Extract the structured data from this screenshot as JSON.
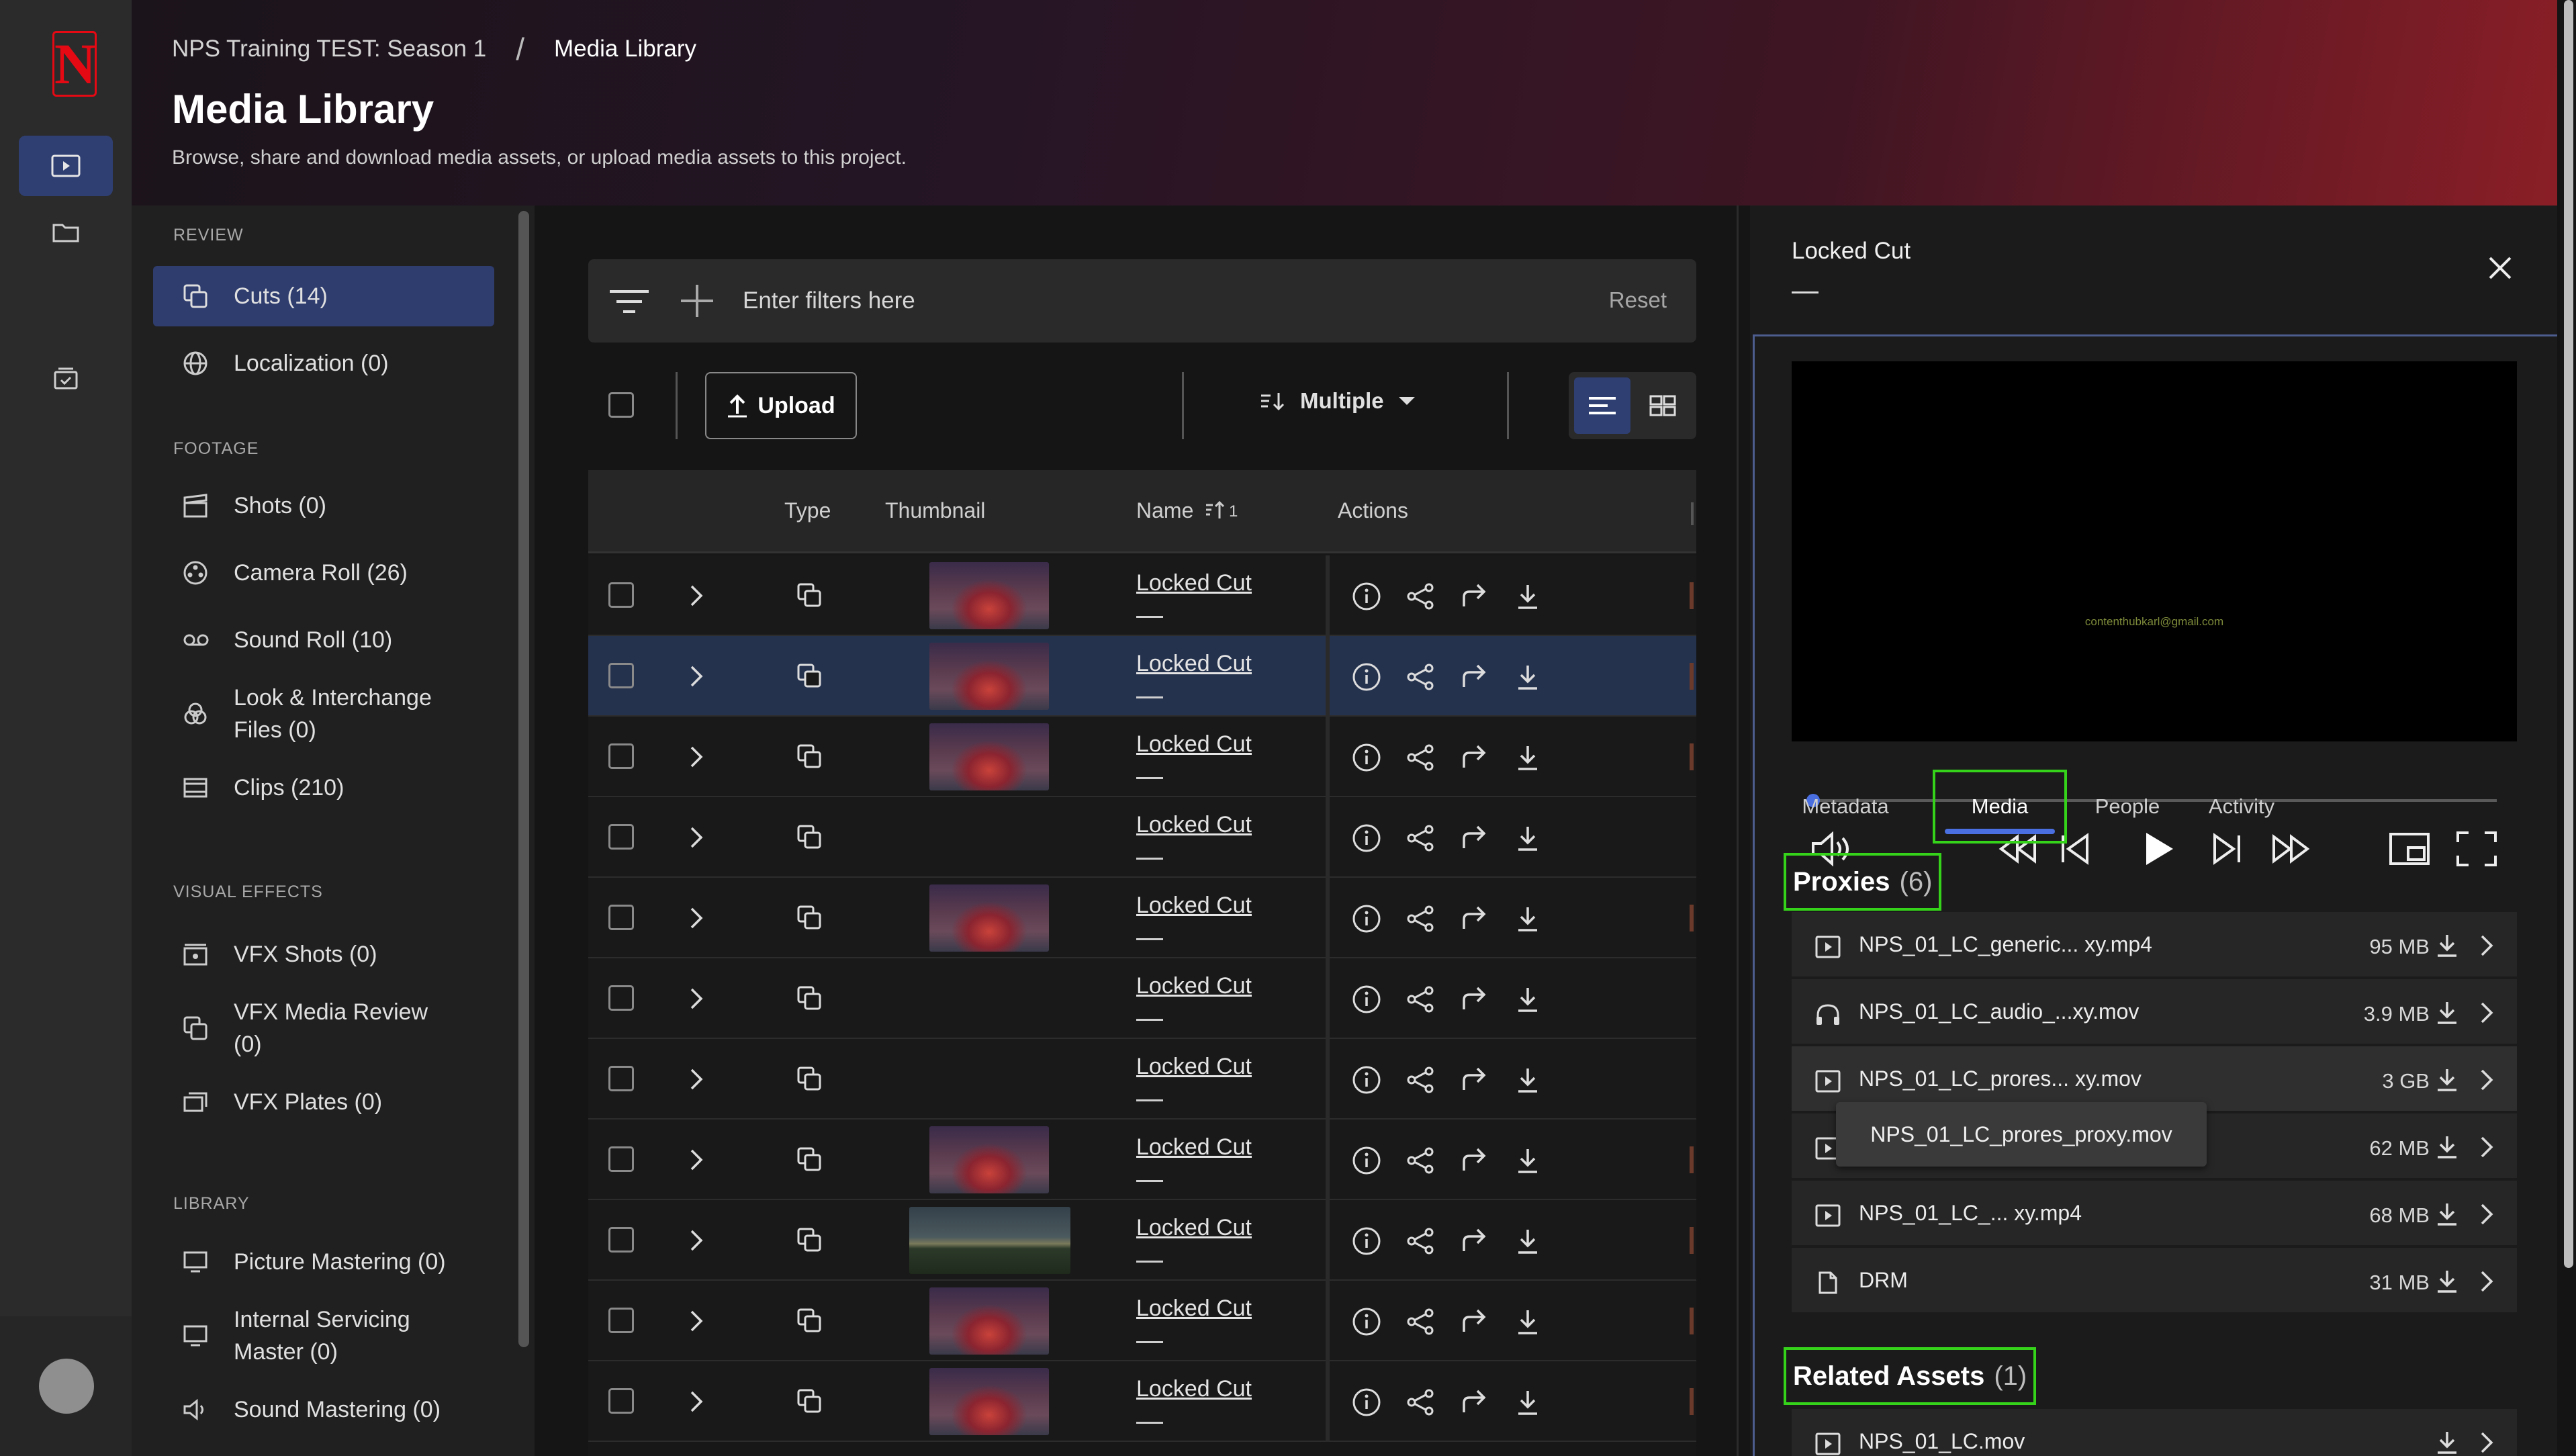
{
  "brand": {
    "logo_letter": "N",
    "accent": "#e50914"
  },
  "header": {
    "breadcrumb_project": "NPS Training TEST: Season 1",
    "breadcrumb_sep": "/",
    "breadcrumb_current": "Media Library",
    "title": "Media Library",
    "subtitle": "Browse, share and download media assets, or upload media assets to this project."
  },
  "sidenav": {
    "sections": [
      {
        "title": "REVIEW",
        "items": [
          {
            "label": "Cuts (14)",
            "icon": "cuts-icon",
            "selected": true
          },
          {
            "label": "Localization (0)",
            "icon": "globe-icon"
          }
        ]
      },
      {
        "title": "FOOTAGE",
        "items": [
          {
            "label": "Shots (0)",
            "icon": "clapper-icon"
          },
          {
            "label": "Camera Roll (26)",
            "icon": "film-reel-icon"
          },
          {
            "label": "Sound Roll (10)",
            "icon": "tape-icon"
          },
          {
            "label": "Look & Interchange Files (0)",
            "icon": "color-wheel-icon"
          },
          {
            "label": "Clips (210)",
            "icon": "film-strip-icon"
          }
        ]
      },
      {
        "title": "VISUAL EFFECTS",
        "items": [
          {
            "label": "VFX Shots (0)",
            "icon": "vfx-shot-icon"
          },
          {
            "label": "VFX Media Review (0)",
            "icon": "vfx-review-icon"
          },
          {
            "label": "VFX Plates (0)",
            "icon": "vfx-plates-icon"
          }
        ]
      },
      {
        "title": "LIBRARY",
        "items": [
          {
            "label": "Picture Mastering (0)",
            "icon": "monitor-icon"
          },
          {
            "label": "Internal Servicing Master (0)",
            "icon": "monitor-icon"
          },
          {
            "label": "Sound Mastering (0)",
            "icon": "speaker-icon"
          }
        ]
      }
    ]
  },
  "filters": {
    "placeholder": "Enter filters here",
    "reset_label": "Reset"
  },
  "toolbar": {
    "upload_label": "Upload",
    "sort_label": "Multiple"
  },
  "table": {
    "columns": {
      "type": "Type",
      "thumbnail": "Thumbnail",
      "name": "Name",
      "name_sort_order": "1",
      "actions": "Actions"
    },
    "rows": [
      {
        "name": "Locked Cut",
        "thumb": "fire"
      },
      {
        "name": "Locked Cut",
        "thumb": "fire",
        "highlighted": true
      },
      {
        "name": "Locked Cut",
        "thumb": "fire"
      },
      {
        "name": "Locked Cut",
        "thumb": "none"
      },
      {
        "name": "Locked Cut",
        "thumb": "fire"
      },
      {
        "name": "Locked Cut",
        "thumb": "none"
      },
      {
        "name": "Locked Cut",
        "thumb": "none"
      },
      {
        "name": "Locked Cut",
        "thumb": "fire"
      },
      {
        "name": "Locked Cut",
        "thumb": "landscape"
      },
      {
        "name": "Locked Cut",
        "thumb": "fire"
      },
      {
        "name": "Locked Cut",
        "thumb": "fire"
      }
    ]
  },
  "panel": {
    "title": "Locked Cut",
    "player": {
      "watermark": "contenthubkarl@gmail.com",
      "progress": 0.0
    },
    "tabs": [
      {
        "label": "Metadata"
      },
      {
        "label": "Media",
        "active": true
      },
      {
        "label": "People"
      },
      {
        "label": "Activity"
      }
    ],
    "proxies": {
      "title": "Proxies",
      "count": "(6)",
      "files": [
        {
          "name": "NPS_01_LC_generic... xy.mp4",
          "size": "95 MB",
          "icon": "video-file-icon"
        },
        {
          "name": "NPS_01_LC_audio_...xy.mov",
          "size": "3.9 MB",
          "icon": "headphones-icon"
        },
        {
          "name": "NPS_01_LC_prores... xy.mov",
          "size": "3 GB",
          "icon": "video-file-icon"
        },
        {
          "name": "",
          "size": "62 MB",
          "icon": "video-file-icon"
        },
        {
          "name": "NPS_01_LC_... xy.mp4",
          "size": "68 MB",
          "icon": "video-file-icon"
        },
        {
          "name": "DRM",
          "size": "31 MB",
          "icon": "document-icon"
        }
      ],
      "tooltip": "NPS_01_LC_prores_proxy.mov"
    },
    "related": {
      "title": "Related Assets",
      "count": "(1)",
      "files": [
        {
          "name": "NPS_01_LC.mov",
          "icon": "video-file-icon"
        }
      ]
    }
  }
}
